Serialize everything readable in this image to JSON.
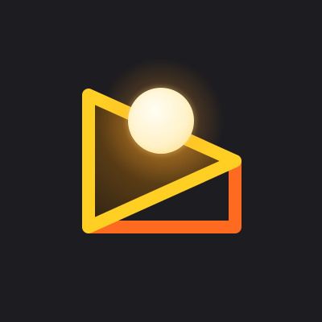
{
  "app_icon": {
    "name": "play-with-sun-logo",
    "description": "",
    "colors": {
      "background": "#1d1c20",
      "outline_yellow": "#ffcf24",
      "outline_orange": "#ff6a21",
      "fill_inner": "#4a3416",
      "sun_center": "#fff9e8",
      "sun_edge": "#ffe9a8",
      "glow": "#ffb640"
    }
  }
}
